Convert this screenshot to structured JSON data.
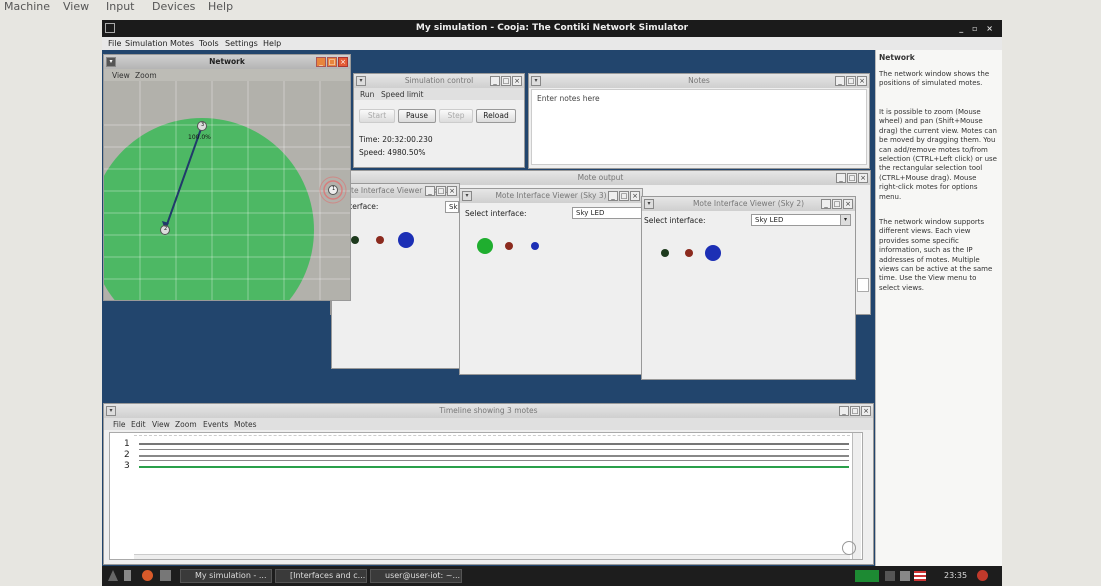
{
  "host_menu": [
    "Machine",
    "View",
    "Input",
    "Devices",
    "Help"
  ],
  "window": {
    "title": "My simulation - Cooja: The Contiki Network Simulator",
    "controls": "_ ▫ ×"
  },
  "app_menu": [
    "File",
    "Simulation",
    "Motes",
    "Tools",
    "Settings",
    "Help"
  ],
  "network": {
    "title": "Network",
    "menu": [
      "View",
      "Zoom"
    ],
    "mote_labels": [
      "3",
      "2",
      "1"
    ],
    "link_label": "100.0%"
  },
  "sim_control": {
    "title": "Simulation control",
    "menu": [
      "Run",
      "Speed limit"
    ],
    "buttons": [
      "Start",
      "Pause",
      "Step",
      "Reload"
    ],
    "time": "Time: 20:32:00.230",
    "speed": "Speed: 4980.50%"
  },
  "notes": {
    "title": "Notes",
    "placeholder": "Enter notes here"
  },
  "mote_output": {
    "title": "Mote output"
  },
  "viewers": [
    {
      "title": "Mote Interface Viewer (Sky 1)",
      "select_label": "ct interface:",
      "select_value": "Sk"
    },
    {
      "title": "Mote Interface Viewer (Sky 3)",
      "select_label": "Select interface:",
      "select_value": "Sky LED"
    },
    {
      "title": "Mote Interface Viewer (Sky 2)",
      "select_label": "Select interface:",
      "select_value": "Sky LED"
    }
  ],
  "timeline": {
    "title": "Timeline showing 3 motes",
    "menu": [
      "File",
      "Edit",
      "View",
      "Zoom",
      "Events",
      "Motes"
    ],
    "rows": [
      "1",
      "2",
      "3"
    ]
  },
  "help": {
    "title": "Network",
    "paragraphs": [
      "The network window shows the positions of simulated motes.",
      "It is possible to zoom (Mouse wheel) and pan (Shift+Mouse drag) the current view. Motes can be moved by dragging them. You can add/remove motes to/from selection (CTRL+Left click) or use the rectangular selection tool (CTRL+Mouse drag). Mouse right-click motes for options menu.",
      "The network window supports different views. Each view provides some specific information, such as the IP addresses of motes. Multiple views can be active at the same time. Use the View menu to select views."
    ]
  },
  "taskbar": {
    "tasks": [
      "My simulation - ...",
      "[Interfaces and c...",
      "user@user-iot: ~..."
    ],
    "clock": "23:35"
  },
  "colors": {
    "led_green": "#1fae2f",
    "led_red": "#8b2a1e",
    "led_blue": "#1c2fb5",
    "radio_range": "#4db864"
  }
}
